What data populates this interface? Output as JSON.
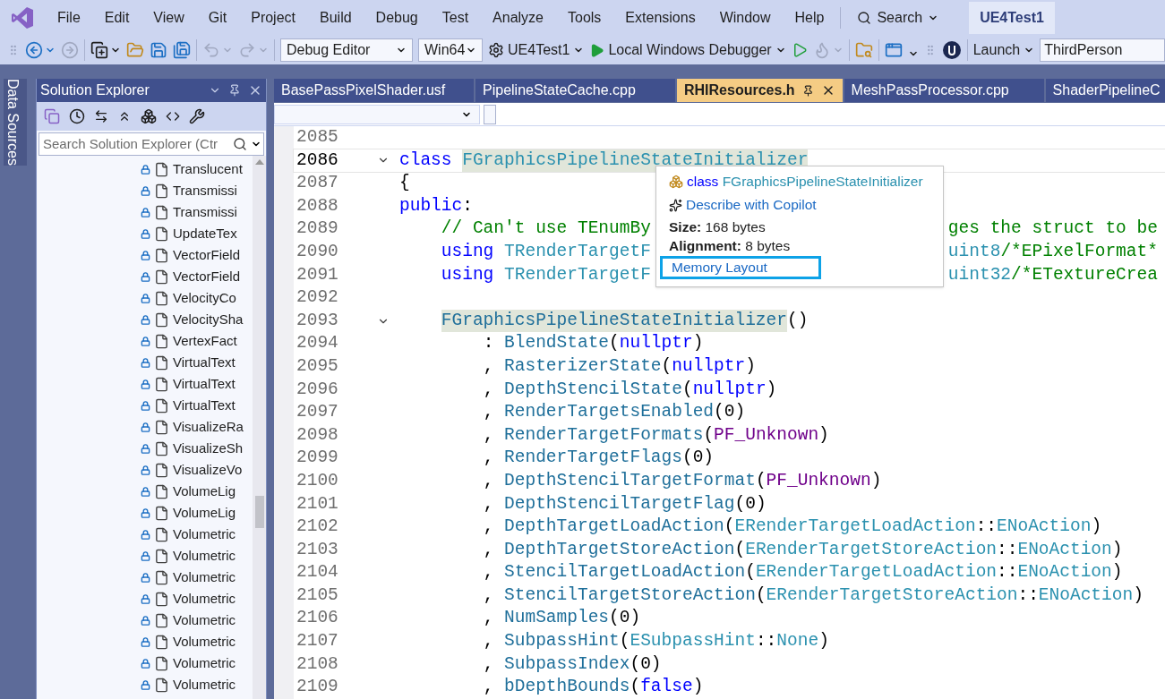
{
  "menu_bar": {
    "items": [
      "File",
      "Edit",
      "View",
      "Git",
      "Project",
      "Build",
      "Debug",
      "Test",
      "Analyze",
      "Tools",
      "Extensions",
      "Window",
      "Help"
    ],
    "search": "Search",
    "solution_name": "UE4Test1"
  },
  "toolbar": [
    {
      "kind": "grip"
    },
    {
      "kind": "back",
      "disabled": false
    },
    {
      "kind": "forward",
      "disabled": true
    },
    {
      "kind": "separator"
    },
    {
      "kind": "new-item",
      "disabled": false
    },
    {
      "kind": "open",
      "disabled": false
    },
    {
      "kind": "save",
      "disabled": false
    },
    {
      "kind": "save-all",
      "disabled": false
    },
    {
      "kind": "separator"
    },
    {
      "kind": "undo",
      "disabled": true
    },
    {
      "kind": "redo",
      "disabled": true
    },
    {
      "kind": "separator"
    },
    {
      "kind": "combo",
      "text": "Debug Editor",
      "wide": true
    },
    {
      "kind": "combo",
      "text": "Win64",
      "wide": false
    },
    {
      "kind": "project",
      "text": "UE4Test1"
    },
    {
      "kind": "run",
      "text": "Local Windows Debugger"
    },
    {
      "kind": "run-nodebug",
      "disabled": false
    },
    {
      "kind": "hot-reload",
      "disabled": true
    },
    {
      "kind": "separator"
    },
    {
      "kind": "find-folder",
      "disabled": false
    },
    {
      "kind": "separator"
    },
    {
      "kind": "window-home",
      "disabled": false
    },
    {
      "kind": "overflow"
    },
    {
      "kind": "grip"
    },
    {
      "kind": "engine",
      "disabled": false
    },
    {
      "kind": "separator"
    },
    {
      "kind": "menu",
      "text": "Launch"
    },
    {
      "kind": "input",
      "text": "ThirdPerson"
    }
  ],
  "side_tab": "Data Sources",
  "solution_explorer": {
    "title": "Solution Explorer",
    "search": {
      "placeholder": "Search Solution Explorer (Ctr"
    },
    "items": [
      {
        "name": "Translucent",
        "checked_in": true
      },
      {
        "name": "Transmissi",
        "checked_in": true
      },
      {
        "name": "Transmissi",
        "checked_in": true
      },
      {
        "name": "UpdateTex",
        "checked_in": true
      },
      {
        "name": "VectorField",
        "checked_in": true
      },
      {
        "name": "VectorField",
        "checked_in": true
      },
      {
        "name": "VelocityCo",
        "checked_in": true
      },
      {
        "name": "VelocitySha",
        "checked_in": true
      },
      {
        "name": "VertexFact",
        "checked_in": true
      },
      {
        "name": "VirtualText",
        "checked_in": true
      },
      {
        "name": "VirtualText",
        "checked_in": true
      },
      {
        "name": "VirtualText",
        "checked_in": true
      },
      {
        "name": "VisualizeRa",
        "checked_in": true
      },
      {
        "name": "VisualizeSh",
        "checked_in": true
      },
      {
        "name": "VisualizeVo",
        "checked_in": true
      },
      {
        "name": "VolumeLig",
        "checked_in": true
      },
      {
        "name": "VolumeLig",
        "checked_in": true
      },
      {
        "name": "Volumetric",
        "checked_in": true
      },
      {
        "name": "Volumetric",
        "checked_in": true
      },
      {
        "name": "Volumetric",
        "checked_in": true
      },
      {
        "name": "Volumetric",
        "checked_in": true
      },
      {
        "name": "Volumetric",
        "checked_in": true
      },
      {
        "name": "Volumetric",
        "checked_in": true
      },
      {
        "name": "Volumetric",
        "checked_in": true
      },
      {
        "name": "Volumetric",
        "checked_in": true
      }
    ]
  },
  "tabs": [
    {
      "label": "BasePassPixelShader.usf",
      "selected": false,
      "pinned": false
    },
    {
      "label": "PipelineStateCache.cpp",
      "selected": false,
      "pinned": false
    },
    {
      "label": "RHIResources.h",
      "selected": true,
      "pinned": true
    },
    {
      "label": "MeshPassProcessor.cpp",
      "selected": false,
      "pinned": false
    },
    {
      "label": "ShaderPipelineC",
      "selected": false,
      "pinned": false
    }
  ],
  "code": [
    {
      "number": "2085",
      "current": false,
      "foldable": false
    },
    {
      "number": "2086",
      "current": true,
      "foldable": true,
      "tokens": [
        {
          "kind": "keyword",
          "text": "class "
        },
        {
          "kind": "type",
          "text": "FGraphicsPipelineStateInitializer",
          "highlighted": true
        }
      ]
    },
    {
      "number": "2087",
      "current": false,
      "foldable": false,
      "tokens": [
        {
          "kind": "plain",
          "text": "{"
        }
      ]
    },
    {
      "number": "2088",
      "current": false,
      "foldable": false,
      "tokens": [
        {
          "kind": "keyword",
          "text": "public"
        },
        {
          "kind": "plain",
          "text": ":"
        }
      ]
    },
    {
      "number": "2089",
      "current": false,
      "foldable": false,
      "tokens": [
        {
          "kind": "comment",
          "text": "    // Can't use TEnumBy"
        }
      ],
      "tokens_after_popup": [
        {
          "kind": "comment",
          "text": "ges the struct to be"
        }
      ]
    },
    {
      "number": "2090",
      "current": false,
      "foldable": false,
      "tokens": [
        {
          "kind": "keyword",
          "text": "    using "
        },
        {
          "kind": "type",
          "text": "TRenderTargetF"
        }
      ],
      "tokens_after_popup": [
        {
          "kind": "type",
          "text": "uint8"
        },
        {
          "kind": "comment",
          "text": "/*EPixelFormat*"
        }
      ]
    },
    {
      "number": "2091",
      "current": false,
      "foldable": false,
      "tokens": [
        {
          "kind": "keyword",
          "text": "    using "
        },
        {
          "kind": "type",
          "text": "TRenderTargetF"
        }
      ],
      "tokens_after_popup": [
        {
          "kind": "type",
          "text": "uint32"
        },
        {
          "kind": "comment",
          "text": "/*ETextureCrea"
        }
      ]
    },
    {
      "number": "2092",
      "current": false,
      "foldable": false
    },
    {
      "number": "2093",
      "current": false,
      "foldable": true,
      "tokens": [
        {
          "kind": "member",
          "text": "    FGraphicsPipelineStateInitializer",
          "highlighted": true
        },
        {
          "kind": "plain",
          "text": "()"
        }
      ]
    },
    {
      "number": "2094",
      "current": false,
      "foldable": false,
      "tokens": [
        {
          "kind": "plain",
          "text": "        : "
        },
        {
          "kind": "member",
          "text": "BlendState"
        },
        {
          "kind": "plain",
          "text": "("
        },
        {
          "kind": "keyword",
          "text": "nullptr"
        },
        {
          "kind": "plain",
          "text": ")"
        }
      ]
    },
    {
      "number": "2095",
      "current": false,
      "foldable": false,
      "tokens": [
        {
          "kind": "plain",
          "text": "        , "
        },
        {
          "kind": "member",
          "text": "RasterizerState"
        },
        {
          "kind": "plain",
          "text": "("
        },
        {
          "kind": "keyword",
          "text": "nullptr"
        },
        {
          "kind": "plain",
          "text": ")"
        }
      ]
    },
    {
      "number": "2096",
      "current": false,
      "foldable": false,
      "tokens": [
        {
          "kind": "plain",
          "text": "        , "
        },
        {
          "kind": "member",
          "text": "DepthStencilState"
        },
        {
          "kind": "plain",
          "text": "("
        },
        {
          "kind": "keyword",
          "text": "nullptr"
        },
        {
          "kind": "plain",
          "text": ")"
        }
      ]
    },
    {
      "number": "2097",
      "current": false,
      "foldable": false,
      "tokens": [
        {
          "kind": "plain",
          "text": "        , "
        },
        {
          "kind": "member",
          "text": "RenderTargetsEnabled"
        },
        {
          "kind": "plain",
          "text": "(0)"
        }
      ]
    },
    {
      "number": "2098",
      "current": false,
      "foldable": false,
      "tokens": [
        {
          "kind": "plain",
          "text": "        , "
        },
        {
          "kind": "member",
          "text": "RenderTargetFormats"
        },
        {
          "kind": "plain",
          "text": "("
        },
        {
          "kind": "macro",
          "text": "PF_Unknown"
        },
        {
          "kind": "plain",
          "text": ")"
        }
      ]
    },
    {
      "number": "2099",
      "current": false,
      "foldable": false,
      "tokens": [
        {
          "kind": "plain",
          "text": "        , "
        },
        {
          "kind": "member",
          "text": "RenderTargetFlags"
        },
        {
          "kind": "plain",
          "text": "(0)"
        }
      ]
    },
    {
      "number": "2100",
      "current": false,
      "foldable": false,
      "tokens": [
        {
          "kind": "plain",
          "text": "        , "
        },
        {
          "kind": "member",
          "text": "DepthStencilTargetFormat"
        },
        {
          "kind": "plain",
          "text": "("
        },
        {
          "kind": "macro",
          "text": "PF_Unknown"
        },
        {
          "kind": "plain",
          "text": ")"
        }
      ]
    },
    {
      "number": "2101",
      "current": false,
      "foldable": false,
      "tokens": [
        {
          "kind": "plain",
          "text": "        , "
        },
        {
          "kind": "member",
          "text": "DepthStencilTargetFlag"
        },
        {
          "kind": "plain",
          "text": "(0)"
        }
      ]
    },
    {
      "number": "2102",
      "current": false,
      "foldable": false,
      "tokens": [
        {
          "kind": "plain",
          "text": "        , "
        },
        {
          "kind": "member",
          "text": "DepthTargetLoadAction"
        },
        {
          "kind": "plain",
          "text": "("
        },
        {
          "kind": "type",
          "text": "ERenderTargetLoadAction"
        },
        {
          "kind": "plain",
          "text": "::"
        },
        {
          "kind": "type",
          "text": "ENoAction"
        },
        {
          "kind": "plain",
          "text": ")"
        }
      ]
    },
    {
      "number": "2103",
      "current": false,
      "foldable": false,
      "tokens": [
        {
          "kind": "plain",
          "text": "        , "
        },
        {
          "kind": "member",
          "text": "DepthTargetStoreAction"
        },
        {
          "kind": "plain",
          "text": "("
        },
        {
          "kind": "type",
          "text": "ERenderTargetStoreAction"
        },
        {
          "kind": "plain",
          "text": "::"
        },
        {
          "kind": "type",
          "text": "ENoAction"
        },
        {
          "kind": "plain",
          "text": ")"
        }
      ]
    },
    {
      "number": "2104",
      "current": false,
      "foldable": false,
      "tokens": [
        {
          "kind": "plain",
          "text": "        , "
        },
        {
          "kind": "member",
          "text": "StencilTargetLoadAction"
        },
        {
          "kind": "plain",
          "text": "("
        },
        {
          "kind": "type",
          "text": "ERenderTargetLoadAction"
        },
        {
          "kind": "plain",
          "text": "::"
        },
        {
          "kind": "type",
          "text": "ENoAction"
        },
        {
          "kind": "plain",
          "text": ")"
        }
      ]
    },
    {
      "number": "2105",
      "current": false,
      "foldable": false,
      "tokens": [
        {
          "kind": "plain",
          "text": "        , "
        },
        {
          "kind": "member",
          "text": "StencilTargetStoreAction"
        },
        {
          "kind": "plain",
          "text": "("
        },
        {
          "kind": "type",
          "text": "ERenderTargetStoreAction"
        },
        {
          "kind": "plain",
          "text": "::"
        },
        {
          "kind": "type",
          "text": "ENoAction"
        },
        {
          "kind": "plain",
          "text": ")"
        }
      ]
    },
    {
      "number": "2106",
      "current": false,
      "foldable": false,
      "tokens": [
        {
          "kind": "plain",
          "text": "        , "
        },
        {
          "kind": "member",
          "text": "NumSamples"
        },
        {
          "kind": "plain",
          "text": "(0)"
        }
      ]
    },
    {
      "number": "2107",
      "current": false,
      "foldable": false,
      "tokens": [
        {
          "kind": "plain",
          "text": "        , "
        },
        {
          "kind": "member",
          "text": "SubpassHint"
        },
        {
          "kind": "plain",
          "text": "("
        },
        {
          "kind": "type",
          "text": "ESubpassHint"
        },
        {
          "kind": "plain",
          "text": "::"
        },
        {
          "kind": "type",
          "text": "None"
        },
        {
          "kind": "plain",
          "text": ")"
        }
      ]
    },
    {
      "number": "2108",
      "current": false,
      "foldable": false,
      "tokens": [
        {
          "kind": "plain",
          "text": "        , "
        },
        {
          "kind": "member",
          "text": "SubpassIndex"
        },
        {
          "kind": "plain",
          "text": "(0)"
        }
      ]
    },
    {
      "number": "2109",
      "current": false,
      "foldable": false,
      "tokens": [
        {
          "kind": "plain",
          "text": "        , "
        },
        {
          "kind": "member",
          "text": "bDepthBounds"
        },
        {
          "kind": "plain",
          "text": "("
        },
        {
          "kind": "keyword",
          "text": "false"
        },
        {
          "kind": "plain",
          "text": ")"
        }
      ]
    }
  ],
  "quick_info": [
    {
      "kind": "symbol",
      "keyword": "class",
      "text": "FGraphicsPipelineStateInitializer"
    },
    {
      "kind": "action",
      "text": "Describe with Copilot"
    },
    {
      "kind": "fact",
      "label": "Size:",
      "text": "168 bytes"
    },
    {
      "kind": "fact",
      "label": "Alignment:",
      "text": "8 bytes"
    },
    {
      "kind": "link",
      "text": "Memory Layout",
      "focused": true
    }
  ]
}
